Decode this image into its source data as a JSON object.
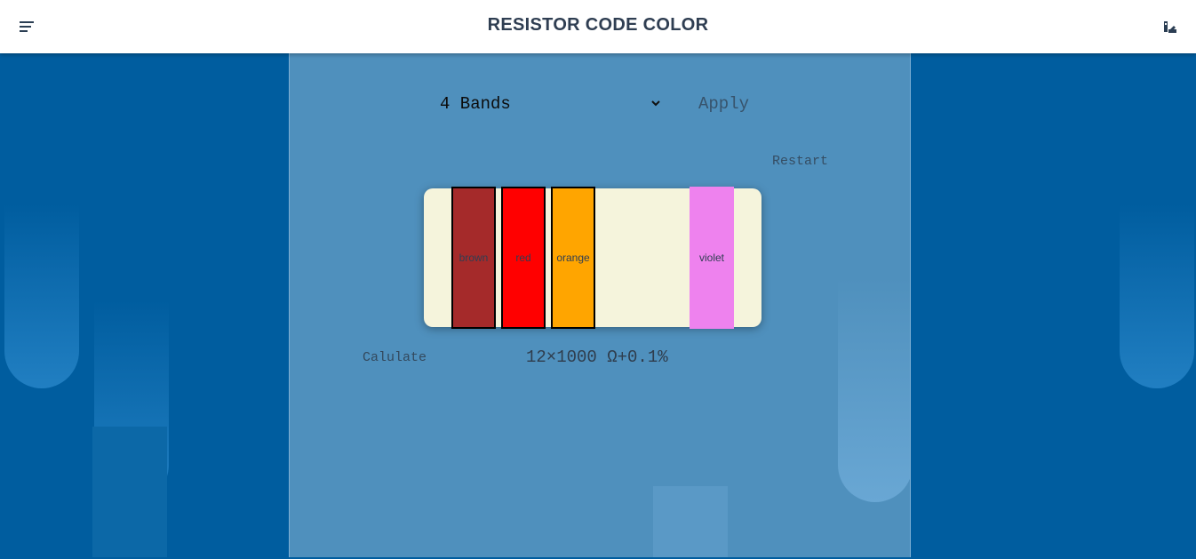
{
  "header": {
    "title": "RESISTOR CODE COLOR",
    "menu_icon": "menu-icon",
    "theme_icon": "palette-icon"
  },
  "controls": {
    "band_select_value": "4 Bands",
    "apply_label": "Apply",
    "restart_label": "Restart",
    "calculate_label": "Calulate"
  },
  "resistor": {
    "body_color": "#f5f4dc",
    "bands": [
      {
        "label": "brown",
        "color": "#a52a2a"
      },
      {
        "label": "red",
        "color": "#ff0000"
      },
      {
        "label": "orange",
        "color": "#ffa500"
      },
      {
        "label": "violet",
        "color": "#ee82ee"
      }
    ]
  },
  "result": {
    "text": "12×1000 Ω+0.1%"
  },
  "theme": {
    "accent": "#005d9f",
    "panel": "#4f90bd"
  }
}
